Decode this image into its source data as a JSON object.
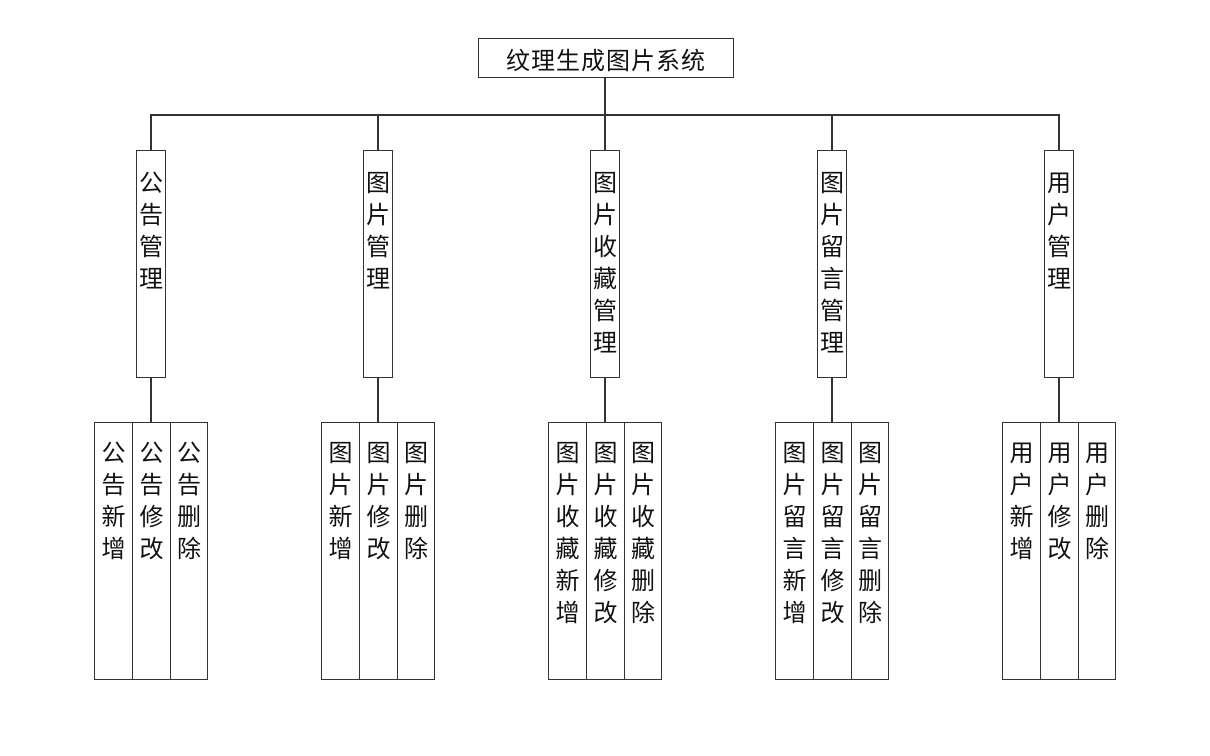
{
  "root": {
    "title": "纹理生成图片系统"
  },
  "modules": [
    {
      "label": "公告管理",
      "children": [
        "公告新增",
        "公告修改",
        "公告删除"
      ]
    },
    {
      "label": "图片管理",
      "children": [
        "图片新增",
        "图片修改",
        "图片删除"
      ]
    },
    {
      "label": "图片收藏管理",
      "children": [
        "图片收藏新增",
        "图片收藏修改",
        "图片收藏删除"
      ]
    },
    {
      "label": "图片留言管理",
      "children": [
        "图片留言新增",
        "图片留言修改",
        "图片留言删除"
      ]
    },
    {
      "label": "用户管理",
      "children": [
        "用户新增",
        "用户修改",
        "用户删除"
      ]
    }
  ]
}
